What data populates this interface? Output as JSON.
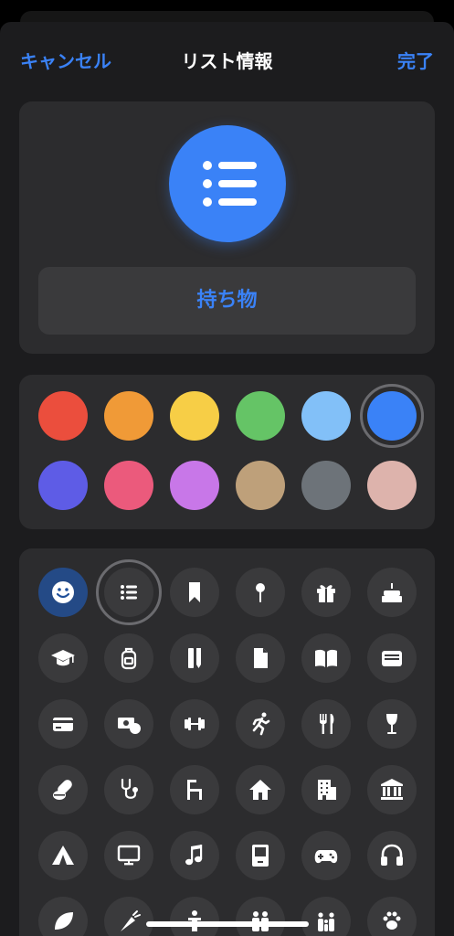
{
  "nav": {
    "cancel": "キャンセル",
    "title": "リスト情報",
    "done": "完了"
  },
  "list": {
    "name": "持ち物",
    "icon": "list-bullet-icon",
    "color": "#3a82f7"
  },
  "colors": [
    {
      "name": "red",
      "hex": "#eb4e3d",
      "selected": false
    },
    {
      "name": "orange",
      "hex": "#f09a37",
      "selected": false
    },
    {
      "name": "yellow",
      "hex": "#f7ce46",
      "selected": false
    },
    {
      "name": "green",
      "hex": "#65c466",
      "selected": false
    },
    {
      "name": "light-blue",
      "hex": "#82c0f8",
      "selected": false
    },
    {
      "name": "blue",
      "hex": "#3a82f7",
      "selected": true
    },
    {
      "name": "indigo",
      "hex": "#5e5ce6",
      "selected": false
    },
    {
      "name": "pink",
      "hex": "#eb5a7c",
      "selected": false
    },
    {
      "name": "purple",
      "hex": "#c877e8",
      "selected": false
    },
    {
      "name": "brown",
      "hex": "#bea07a",
      "selected": false
    },
    {
      "name": "gray",
      "hex": "#6d7379",
      "selected": false
    },
    {
      "name": "rose",
      "hex": "#ddb3ac",
      "selected": false
    }
  ],
  "icons": [
    "smiley-icon",
    "list-bullet-icon",
    "bookmark-icon",
    "pin-icon",
    "gift-icon",
    "birthday-cake-icon",
    "graduation-cap-icon",
    "backpack-icon",
    "ruler-pencil-icon",
    "document-icon",
    "book-icon",
    "wallet-icon",
    "credit-card-icon",
    "money-icon",
    "dumbbell-icon",
    "running-icon",
    "fork-knife-icon",
    "wine-glass-icon",
    "pills-icon",
    "stethoscope-icon",
    "chair-icon",
    "house-icon",
    "building-icon",
    "bank-icon",
    "tent-icon",
    "monitor-icon",
    "music-note-icon",
    "computer-icon",
    "gamepad-icon",
    "headphones-icon",
    "leaf-icon",
    "carrot-icon",
    "person-icon",
    "people-icon",
    "family-icon",
    "paw-icon"
  ],
  "selected_icon": "list-bullet-icon"
}
